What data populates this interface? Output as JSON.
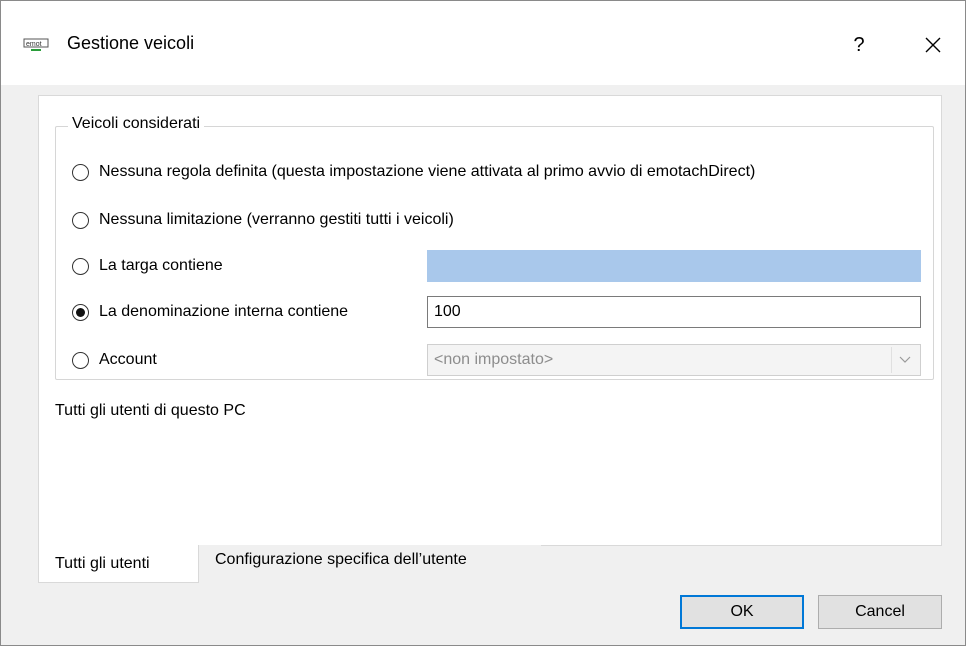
{
  "window": {
    "title": "Gestione veicoli",
    "help_label": "?",
    "close_label": "✕"
  },
  "group": {
    "legend": "Veicoli considerati",
    "options": [
      {
        "label": "Nessuna regola definita (questa impostazione viene attivata al primo avvio di emotachDirect)",
        "checked": false
      },
      {
        "label": "Nessuna limitazione (verranno gestiti tutti i veicoli)",
        "checked": false
      },
      {
        "label": "La targa contiene",
        "checked": false
      },
      {
        "label": "La denominazione interna contiene",
        "checked": true
      },
      {
        "label": "Account",
        "checked": false
      }
    ],
    "plate_value": "",
    "internal_name_value": "100",
    "account_selected": "<non impostato>"
  },
  "scope_text": "Tutti gli utenti di questo PC",
  "tabs": [
    {
      "label": "Tutti gli utenti",
      "active": true
    },
    {
      "label": "Configurazione specifica dell’utente",
      "active": false
    }
  ],
  "buttons": {
    "ok": "OK",
    "cancel": "Cancel"
  },
  "colors": {
    "focus_border": "#0078d7",
    "plate_field_highlight": "#a9c8eb"
  }
}
